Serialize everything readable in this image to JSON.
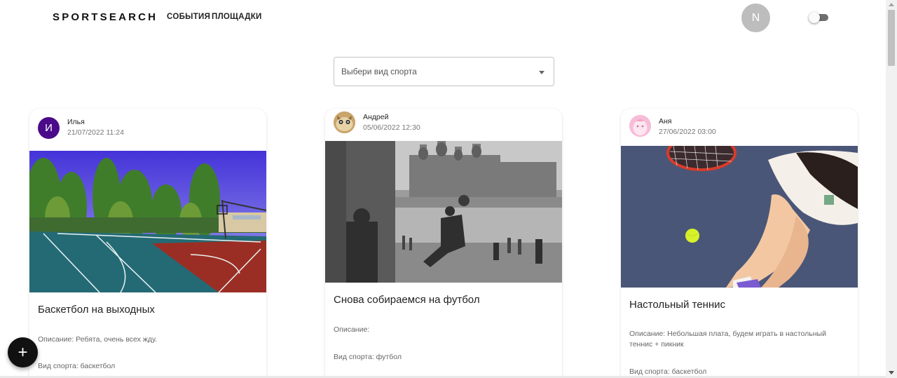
{
  "header": {
    "logo": "SPORTSEARCH",
    "nav": {
      "events": "СОБЫТИЯ",
      "venues": "ПЛОЩАДКИ"
    },
    "user_initial": "N"
  },
  "filter": {
    "placeholder": "Выбери вид спорта"
  },
  "events": [
    {
      "author": "Илья",
      "author_initial": "И",
      "date": "21/07/2022 11:24",
      "title": "Баскетбол на выходных",
      "description": "Описание: Ребята, очень всех жду.",
      "sport": "Вид спорта: баскетбол",
      "image": "basketball-court-photo"
    },
    {
      "author": "Андрей",
      "date": "05/06/2022 12:30",
      "title": "Снова собираемся на футбол",
      "description": "Описание:",
      "sport": "Вид спорта: футбол",
      "image": "vintage-football-photo"
    },
    {
      "author": "Аня",
      "date": "27/06/2022 03:00",
      "title": "Настольный теннис",
      "description": "Описание: Небольшая плата, будем играть в настольный теннис + пикник",
      "sport": "Вид спорта: баскетбол",
      "image": "tennis-photo"
    }
  ],
  "fab": {
    "icon": "plus-icon",
    "label": "+"
  }
}
